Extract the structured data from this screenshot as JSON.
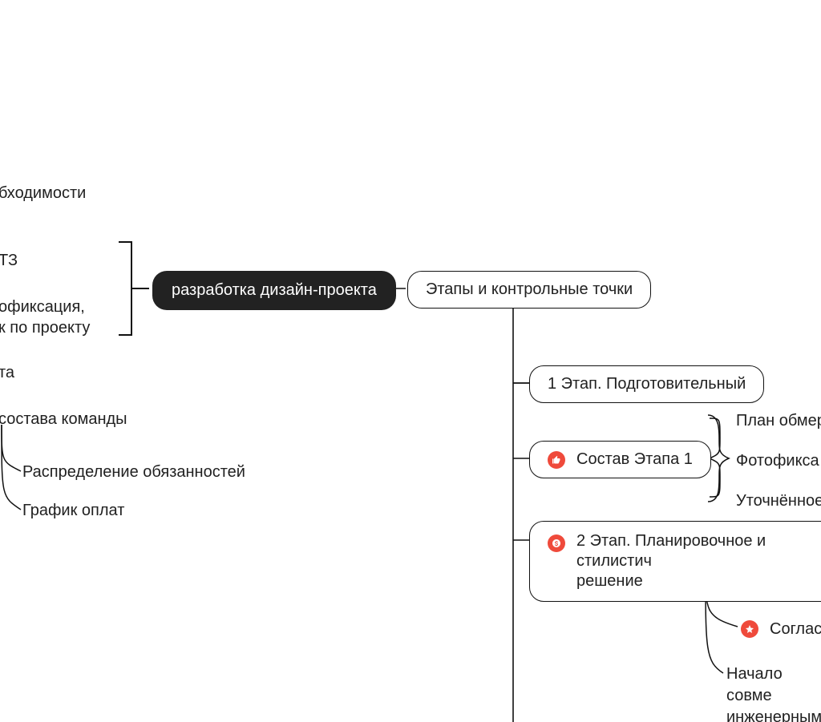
{
  "left": {
    "partial_top": "бходимости",
    "partial_tz": "ТЗ",
    "partial_photo1": "офиксация,",
    "partial_photo2": "к по проекту",
    "partial_ta": "та",
    "partial_team": "состава команды",
    "child1": "Распределение обязанностей",
    "child2": "График оплат"
  },
  "center": {
    "root": "разработка дизайн-проекта",
    "stages": "Этапы и контрольные точки"
  },
  "right": {
    "stage1": "1 Этап. Подготовительный",
    "comp1": "Состав Этапа 1",
    "comp1_items": {
      "a": "План обмер",
      "b": "Фотофикса",
      "c": "Уточнённое"
    },
    "stage2_line1": "2 Этап. Планировочное и стилистич",
    "stage2_line2": "решение",
    "s2_child1": "Согласова",
    "s2_child2_line1": "Начало совме",
    "s2_child2_line2": "инженерными"
  },
  "colors": {
    "red": "#ef4a3b"
  }
}
